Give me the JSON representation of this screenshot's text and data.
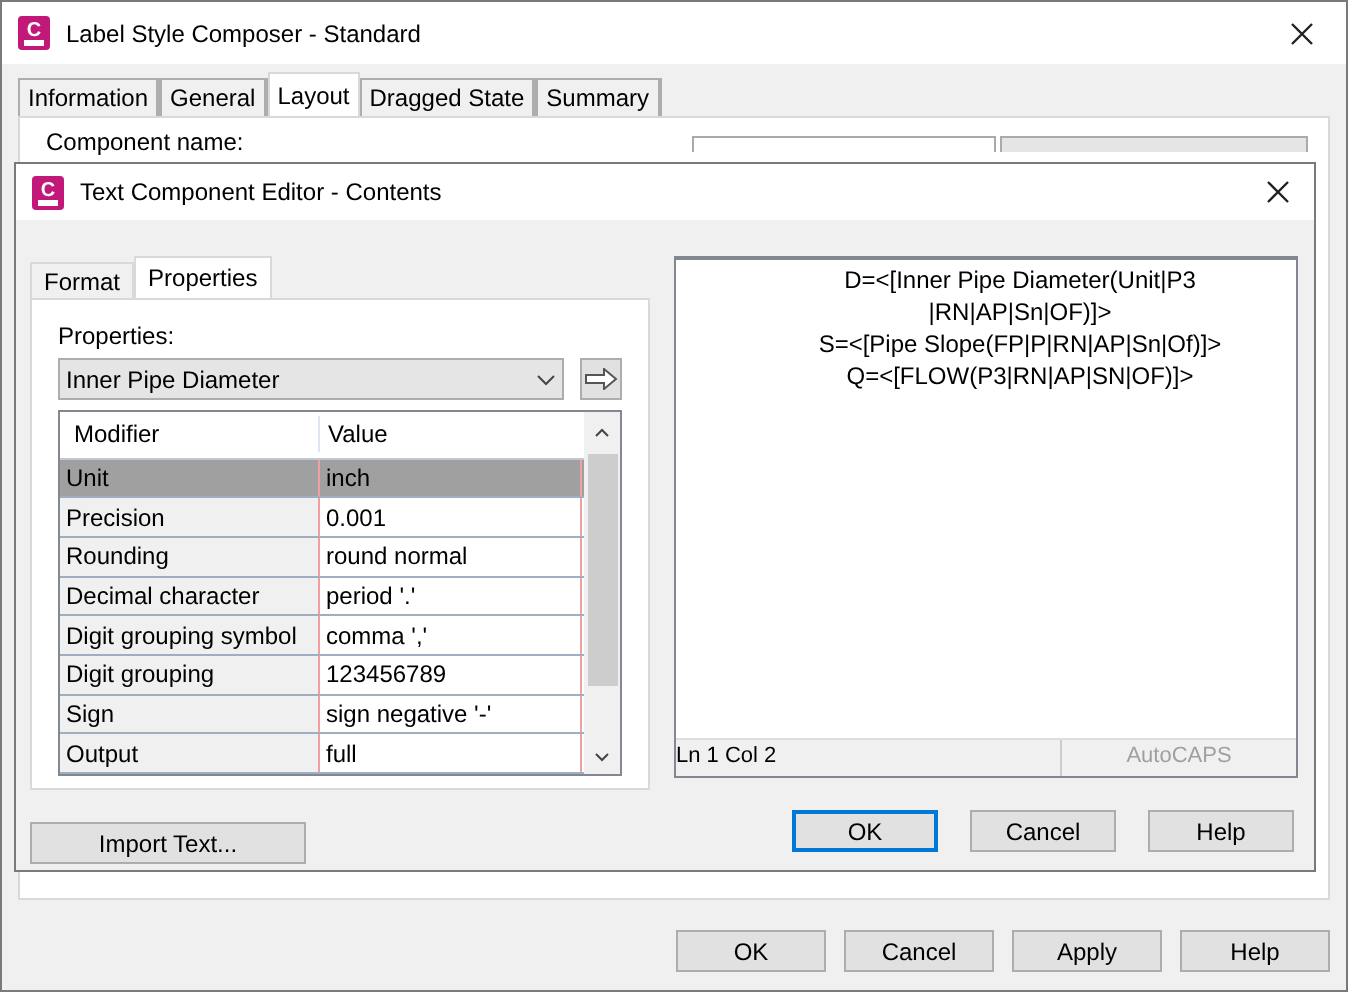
{
  "window": {
    "title": "Label Style Composer - Standard",
    "icon_text": "C"
  },
  "tabs": [
    {
      "label": "Information",
      "selected": false
    },
    {
      "label": "General",
      "selected": false
    },
    {
      "label": "Layout",
      "selected": true
    },
    {
      "label": "Dragged State",
      "selected": false
    },
    {
      "label": "Summary",
      "selected": false
    }
  ],
  "layout_panel": {
    "component_name_label": "Component name:"
  },
  "editor": {
    "title": "Text Component Editor - Contents",
    "icon_text": "C",
    "tabs": [
      {
        "label": "Format",
        "selected": false
      },
      {
        "label": "Properties",
        "selected": true
      }
    ],
    "properties_label": "Properties:",
    "property": "Inner Pipe Diameter",
    "table": {
      "columns": [
        "Modifier",
        "Value"
      ],
      "rows": [
        {
          "modifier": "Unit",
          "value": "inch",
          "selected": true
        },
        {
          "modifier": "Precision",
          "value": "0.001",
          "selected": false
        },
        {
          "modifier": "Rounding",
          "value": "round normal",
          "selected": false
        },
        {
          "modifier": "Decimal character",
          "value": "period '.'",
          "selected": false
        },
        {
          "modifier": "Digit grouping symbol",
          "value": "comma ','",
          "selected": false
        },
        {
          "modifier": "Digit grouping",
          "value": "123456789",
          "selected": false
        },
        {
          "modifier": "Sign",
          "value": "sign negative '-'",
          "selected": false
        },
        {
          "modifier": "Output",
          "value": "full",
          "selected": false
        }
      ]
    },
    "import_button": "Import Text...",
    "preview_lines": [
      "D=<[Inner Pipe Diameter(Unit|P3",
      "|RN|AP|Sn|OF)]>",
      "S=<[Pipe Slope(FP|P|RN|AP|Sn|Of)]>",
      "Q=<[FLOW(P3|RN|AP|SN|OF)]>"
    ],
    "status": {
      "position": "Ln 1 Col 2",
      "autocaps": "AutoCAPS"
    },
    "buttons": [
      {
        "label": "OK",
        "default": true
      },
      {
        "label": "Cancel",
        "default": false
      },
      {
        "label": "Help",
        "default": false
      }
    ]
  },
  "buttons": [
    "OK",
    "Cancel",
    "Apply",
    "Help"
  ]
}
